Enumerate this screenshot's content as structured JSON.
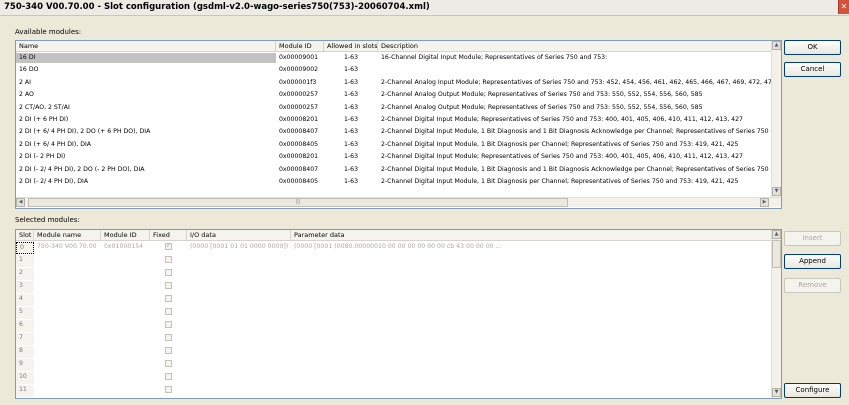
{
  "window": {
    "title": "750-340 V00.70.00 - Slot configuration (gsdml-v2.0-wago-series750(753)-20060704.xml)",
    "close_symbol": "✕"
  },
  "available": {
    "label": "Available modules:",
    "columns": [
      "Name",
      "Module ID",
      "Allowed in slots",
      "Description"
    ],
    "rows": [
      {
        "name": "16 DI",
        "id": "0x00009001",
        "slots": "1-63",
        "desc": "16-Channel Digital Input Module; Representatives of Series 750 and 753:"
      },
      {
        "name": "16 DO",
        "id": "0x00009002",
        "slots": "1-63",
        "desc": ""
      },
      {
        "name": "2 AI",
        "id": "0x000001f3",
        "slots": "1-63",
        "desc": "2-Channel Analog Input Module; Representatives of Series 750 and 753: 452, 454, 456, 461, 462, 465, 466, 467, 469, 472, 474, 47"
      },
      {
        "name": "2 AO",
        "id": "0x00000257",
        "slots": "1-63",
        "desc": "2-Channel Analog Output Module; Representatives of Series 750 and 753: 550, 552, 554, 556, 560, 585"
      },
      {
        "name": "2 CT/AO, 2 ST/AI",
        "id": "0x00000257",
        "slots": "1-63",
        "desc": "2-Channel Analog Output Module; Representatives of Series 750 and 753: 550, 552, 554, 556, 560, 585"
      },
      {
        "name": "2 DI (+ 6 PH DI)",
        "id": "0x00008201",
        "slots": "1-63",
        "desc": "2-Channel Digital Input Module; Representatives of Series 750 and 753: 400, 401, 405, 406, 410, 411, 412, 413, 427"
      },
      {
        "name": "2 DI (+ 6/ 4 PH DI), 2 DO (+ 6 PH DO), DIA",
        "id": "0x00008407",
        "slots": "1-63",
        "desc": "2-Channel Digital Input Module, 1 Bit Diagnosis and 1 Bit Diagnosis Acknowledge per Channel; Representatives of Series 750 and 753"
      },
      {
        "name": "2 DI (+ 6/ 4 PH DI), DIA",
        "id": "0x00008405",
        "slots": "1-63",
        "desc": "2-Channel Digital Input Module, 1 Bit Diagnosis per Channel; Representatives of Series 750 and 753: 419, 421, 425"
      },
      {
        "name": "2 DI (- 2 PH DI)",
        "id": "0x00008201",
        "slots": "1-63",
        "desc": "2-Channel Digital Input Module; Representatives of Series 750 and 753: 400, 401, 405, 406, 410, 411, 412, 413, 427"
      },
      {
        "name": "2 DI (- 2/ 4 PH DI), 2 DO (- 2 PH DO), DIA",
        "id": "0x00008407",
        "slots": "1-63",
        "desc": "2-Channel Digital Input Module, 1 Bit Diagnosis and 1 Bit Diagnosis Acknowledge per Channel; Representatives of Series 750 and 753"
      },
      {
        "name": "2 DI (- 2/ 4 PH DI), DIA",
        "id": "0x00008405",
        "slots": "1-63",
        "desc": "2-Channel Digital Input Module, 1 Bit Diagnosis per Channel; Representatives of Series 750 and 753: 419, 421, 425"
      }
    ],
    "hscroll_grip": "|||"
  },
  "selected": {
    "label": "Selected modules:",
    "columns": [
      "Slot",
      "Module name",
      "Module ID",
      "Fixed",
      "I/O data",
      "Parameter data"
    ],
    "rows": [
      {
        "slot": "0",
        "name": "750-340 V00.70.00",
        "id": "0x01000154",
        "fixed": true,
        "io": "(0000 [0001 01 01 0000 0000])",
        "param": "(0000 [0001 (0080.00000010 00 00 00 00 00 00 cb 43 00 00 00 ..."
      },
      {
        "slot": "1",
        "name": "",
        "id": "",
        "fixed": false,
        "io": "",
        "param": ""
      },
      {
        "slot": "2",
        "name": "",
        "id": "",
        "fixed": false,
        "io": "",
        "param": ""
      },
      {
        "slot": "3",
        "name": "",
        "id": "",
        "fixed": false,
        "io": "",
        "param": ""
      },
      {
        "slot": "4",
        "name": "",
        "id": "",
        "fixed": false,
        "io": "",
        "param": ""
      },
      {
        "slot": "5",
        "name": "",
        "id": "",
        "fixed": false,
        "io": "",
        "param": ""
      },
      {
        "slot": "6",
        "name": "",
        "id": "",
        "fixed": false,
        "io": "",
        "param": ""
      },
      {
        "slot": "7",
        "name": "",
        "id": "",
        "fixed": false,
        "io": "",
        "param": ""
      },
      {
        "slot": "8",
        "name": "",
        "id": "",
        "fixed": false,
        "io": "",
        "param": ""
      },
      {
        "slot": "9",
        "name": "",
        "id": "",
        "fixed": false,
        "io": "",
        "param": ""
      },
      {
        "slot": "10",
        "name": "",
        "id": "",
        "fixed": false,
        "io": "",
        "param": ""
      },
      {
        "slot": "11",
        "name": "",
        "id": "",
        "fixed": false,
        "io": "",
        "param": ""
      }
    ]
  },
  "buttons": {
    "ok": "OK",
    "cancel": "Cancel",
    "insert": "Insert",
    "append": "Append",
    "remove": "Remove",
    "configure": "Configure"
  },
  "icons": {
    "scroll_up": "up-arrow",
    "scroll_down": "down-arrow",
    "scroll_left": "left-arrow",
    "scroll_right": "right-arrow"
  },
  "colors": {
    "selection_grey": "#c2c2c2",
    "panel_border": "#7f9db9",
    "dialog_bg": "#ece9d8"
  }
}
